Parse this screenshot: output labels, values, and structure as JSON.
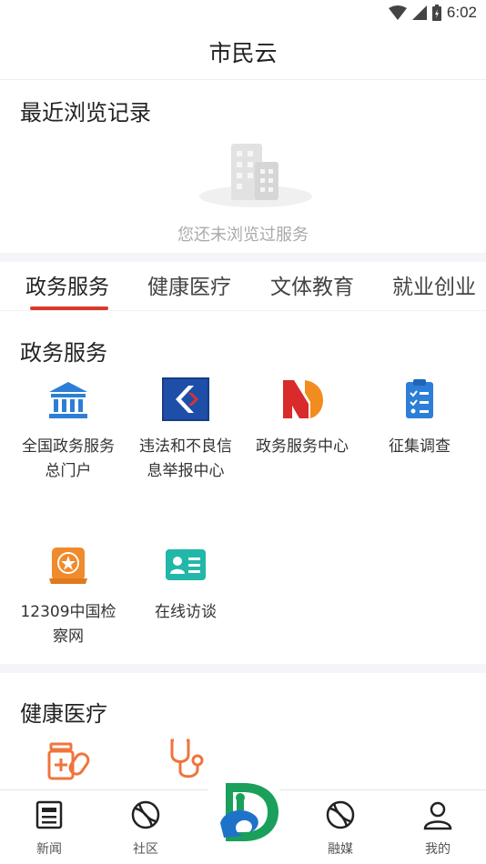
{
  "status_bar": {
    "time": "6:02"
  },
  "header": {
    "title": "市民云"
  },
  "recent": {
    "title": "最近浏览记录",
    "empty_text": "您还未浏览过服务"
  },
  "tabs": [
    {
      "label": "政务服务",
      "active": true
    },
    {
      "label": "健康医疗",
      "active": false
    },
    {
      "label": "文体教育",
      "active": false
    },
    {
      "label": "就业创业",
      "active": false
    }
  ],
  "sections": [
    {
      "title": "政务服务",
      "items": [
        {
          "label": "全国政务服务总门户",
          "icon": "government-building-icon"
        },
        {
          "label": "违法和不良信息举报中心",
          "icon": "report-center-logo-icon"
        },
        {
          "label": "政务服务中心",
          "icon": "service-center-logo-icon"
        },
        {
          "label": "征集调查",
          "icon": "clipboard-survey-icon"
        },
        {
          "label": "12309中国检察网",
          "icon": "procuratorate-emblem-icon"
        },
        {
          "label": "在线访谈",
          "icon": "id-card-interview-icon"
        }
      ]
    },
    {
      "title": "健康医疗",
      "items": [
        {
          "label": "",
          "icon": "medicine-bottle-icon"
        },
        {
          "label": "",
          "icon": "stethoscope-icon"
        }
      ]
    }
  ],
  "bottom_nav": [
    {
      "label": "新闻",
      "icon": "news-icon"
    },
    {
      "label": "社区",
      "icon": "community-icon"
    },
    {
      "label": "",
      "icon": "app-logo-icon"
    },
    {
      "label": "融媒",
      "icon": "media-icon"
    },
    {
      "label": "我的",
      "icon": "profile-icon"
    }
  ],
  "colors": {
    "accent_red": "#d93a2b",
    "blue": "#2d7ed6",
    "orange": "#f08a2c",
    "teal": "#22b7a8",
    "background_gray": "#f4f5f8"
  }
}
